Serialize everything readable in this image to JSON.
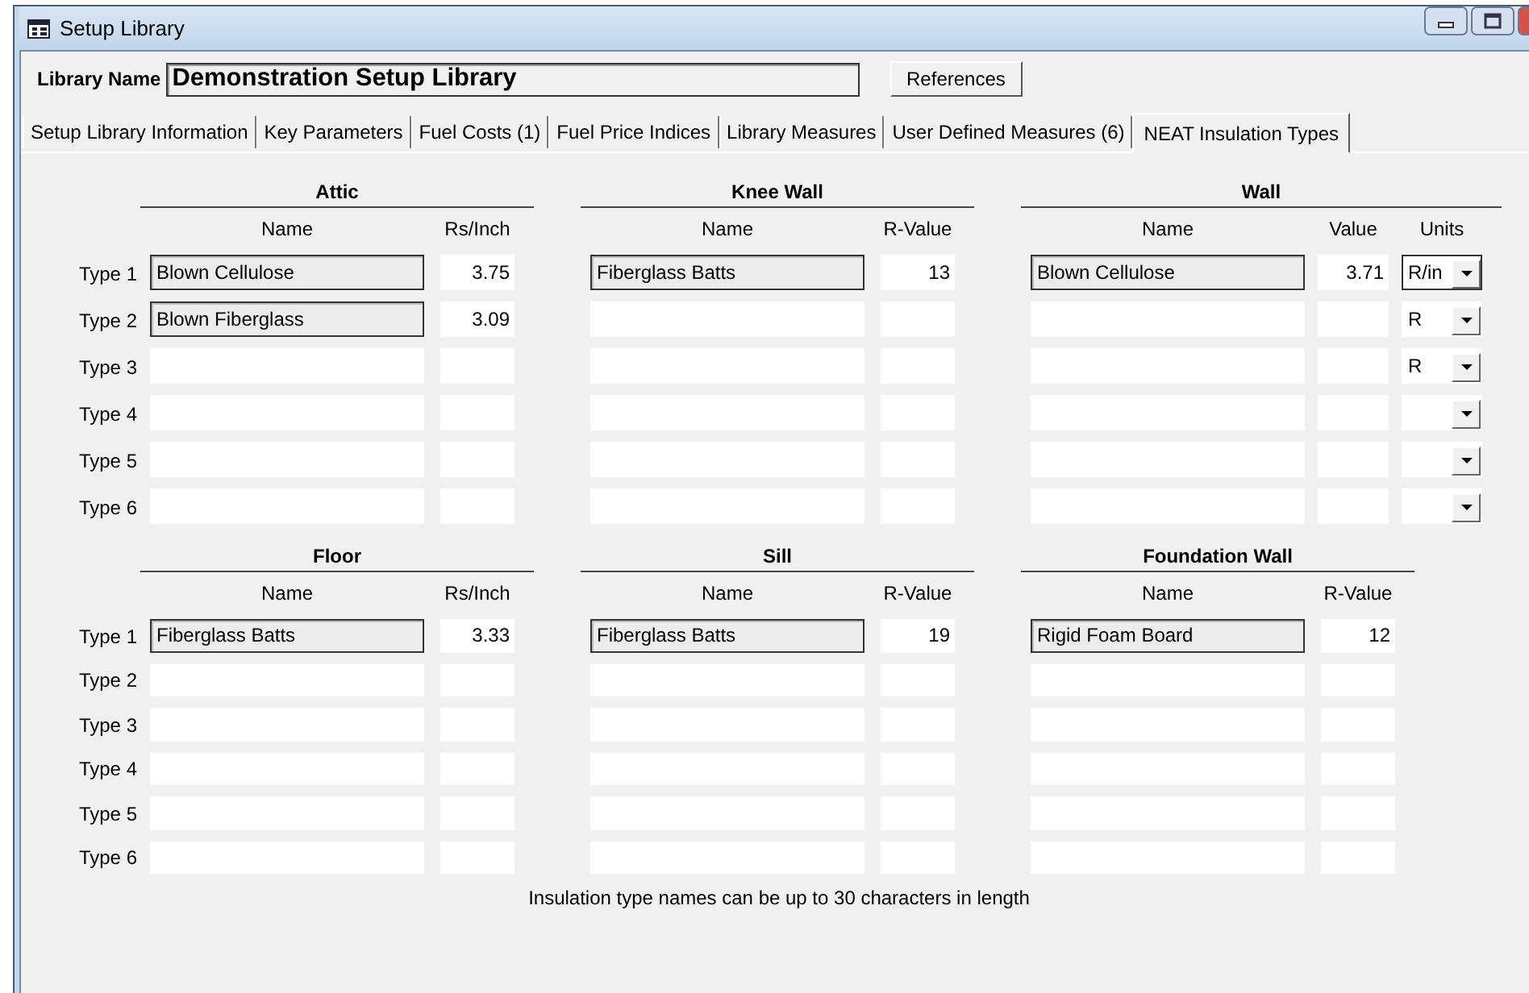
{
  "window": {
    "title": "Setup Library"
  },
  "library_name": {
    "label": "Library Name",
    "value": "Demonstration Setup Library"
  },
  "references_button": "References",
  "tabs": [
    {
      "label": "Setup Library Information",
      "selected": false
    },
    {
      "label": "Key Parameters",
      "selected": false
    },
    {
      "label": "Fuel Costs (1)",
      "selected": false
    },
    {
      "label": "Fuel Price Indices",
      "selected": false
    },
    {
      "label": "Library Measures",
      "selected": false
    },
    {
      "label": "User Defined Measures (6)",
      "selected": false
    },
    {
      "label": "NEAT Insulation Types",
      "selected": true
    }
  ],
  "groups": [
    {
      "row_labels": [
        "Type 1",
        "Type 2",
        "Type 3",
        "Type 4",
        "Type 5",
        "Type 6"
      ],
      "sections": [
        {
          "title": "Attic",
          "kind": "plain",
          "columns": [
            "Name",
            "Rs/Inch"
          ],
          "rows": [
            {
              "name": "Blown Cellulose",
              "value": "3.75"
            },
            {
              "name": "Blown Fiberglass",
              "value": "3.09"
            },
            {},
            {},
            {},
            {}
          ]
        },
        {
          "title": "Knee Wall",
          "kind": "plain",
          "columns": [
            "Name",
            "R-Value"
          ],
          "rows": [
            {
              "name": "Fiberglass Batts",
              "value": "13"
            },
            {},
            {},
            {},
            {},
            {}
          ]
        },
        {
          "title": "Wall",
          "kind": "units",
          "columns": [
            "Name",
            "Value",
            "Units"
          ],
          "rows": [
            {
              "name": "Blown Cellulose",
              "value": "3.71",
              "units": "R/in",
              "focused": true
            },
            {
              "units": "R",
              "focused": false
            },
            {
              "units": "R",
              "focused": false
            },
            {
              "focused": false
            },
            {
              "focused": false
            },
            {
              "focused": false
            }
          ]
        }
      ]
    },
    {
      "row_labels": [
        "Type 1",
        "Type 2",
        "Type 3",
        "Type 4",
        "Type 5",
        "Type 6"
      ],
      "sections": [
        {
          "title": "Floor",
          "kind": "plain",
          "columns": [
            "Name",
            "Rs/Inch"
          ],
          "rows": [
            {
              "name": "Fiberglass Batts",
              "value": "3.33"
            },
            {},
            {},
            {},
            {},
            {}
          ]
        },
        {
          "title": "Sill",
          "kind": "plain",
          "columns": [
            "Name",
            "R-Value"
          ],
          "rows": [
            {
              "name": "Fiberglass Batts",
              "value": "19"
            },
            {},
            {},
            {},
            {},
            {}
          ]
        },
        {
          "title": "Foundation Wall",
          "kind": "plain",
          "columns": [
            "Name",
            "R-Value"
          ],
          "rows": [
            {
              "name": "Rigid Foam Board",
              "value": "12"
            },
            {},
            {},
            {},
            {},
            {}
          ]
        }
      ]
    }
  ],
  "note": "Insulation type names can be up to 30 characters in length"
}
